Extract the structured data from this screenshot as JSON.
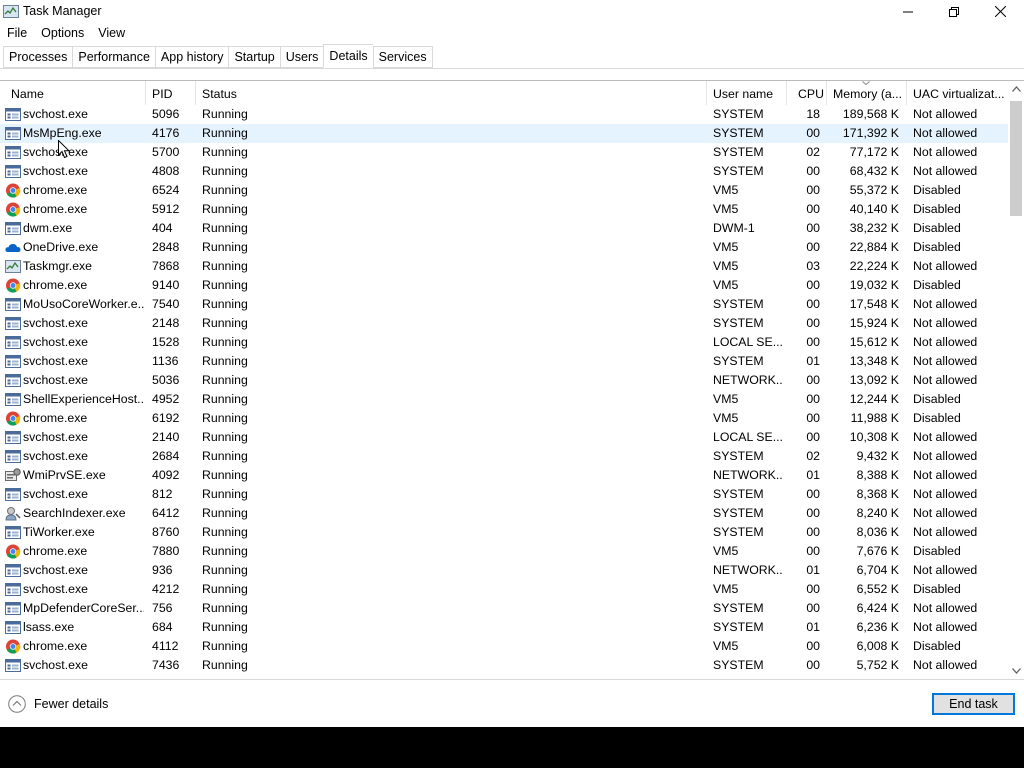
{
  "window": {
    "title": "Task Manager"
  },
  "menu": [
    "File",
    "Options",
    "View"
  ],
  "tabs": [
    {
      "label": "Processes",
      "active": false
    },
    {
      "label": "Performance",
      "active": false
    },
    {
      "label": "App history",
      "active": false
    },
    {
      "label": "Startup",
      "active": false
    },
    {
      "label": "Users",
      "active": false
    },
    {
      "label": "Details",
      "active": true
    },
    {
      "label": "Services",
      "active": false
    }
  ],
  "columns": {
    "name": "Name",
    "pid": "PID",
    "status": "Status",
    "user": "User name",
    "cpu": "CPU",
    "memory": "Memory (a...",
    "uac": "UAC virtualizat..."
  },
  "rows": [
    {
      "icon": "service",
      "name": "svchost.exe",
      "pid": "5096",
      "status": "Running",
      "user": "SYSTEM",
      "cpu": "18",
      "mem": "189,568 K",
      "uac": "Not allowed"
    },
    {
      "icon": "service",
      "name": "MsMpEng.exe",
      "pid": "4176",
      "status": "Running",
      "user": "SYSTEM",
      "cpu": "00",
      "mem": "171,392 K",
      "uac": "Not allowed",
      "selected": true
    },
    {
      "icon": "service",
      "name": "svchost.exe",
      "pid": "5700",
      "status": "Running",
      "user": "SYSTEM",
      "cpu": "02",
      "mem": "77,172 K",
      "uac": "Not allowed"
    },
    {
      "icon": "service",
      "name": "svchost.exe",
      "pid": "4808",
      "status": "Running",
      "user": "SYSTEM",
      "cpu": "00",
      "mem": "68,432 K",
      "uac": "Not allowed"
    },
    {
      "icon": "chrome",
      "name": "chrome.exe",
      "pid": "6524",
      "status": "Running",
      "user": "VM5",
      "cpu": "00",
      "mem": "55,372 K",
      "uac": "Disabled"
    },
    {
      "icon": "chrome",
      "name": "chrome.exe",
      "pid": "5912",
      "status": "Running",
      "user": "VM5",
      "cpu": "00",
      "mem": "40,140 K",
      "uac": "Disabled"
    },
    {
      "icon": "service",
      "name": "dwm.exe",
      "pid": "404",
      "status": "Running",
      "user": "DWM-1",
      "cpu": "00",
      "mem": "38,232 K",
      "uac": "Disabled"
    },
    {
      "icon": "onedrive",
      "name": "OneDrive.exe",
      "pid": "2848",
      "status": "Running",
      "user": "VM5",
      "cpu": "00",
      "mem": "22,884 K",
      "uac": "Disabled"
    },
    {
      "icon": "taskmgr",
      "name": "Taskmgr.exe",
      "pid": "7868",
      "status": "Running",
      "user": "VM5",
      "cpu": "03",
      "mem": "22,224 K",
      "uac": "Not allowed"
    },
    {
      "icon": "chrome",
      "name": "chrome.exe",
      "pid": "9140",
      "status": "Running",
      "user": "VM5",
      "cpu": "00",
      "mem": "19,032 K",
      "uac": "Disabled"
    },
    {
      "icon": "service",
      "name": "MoUsoCoreWorker.e...",
      "pid": "7540",
      "status": "Running",
      "user": "SYSTEM",
      "cpu": "00",
      "mem": "17,548 K",
      "uac": "Not allowed"
    },
    {
      "icon": "service",
      "name": "svchost.exe",
      "pid": "2148",
      "status": "Running",
      "user": "SYSTEM",
      "cpu": "00",
      "mem": "15,924 K",
      "uac": "Not allowed"
    },
    {
      "icon": "service",
      "name": "svchost.exe",
      "pid": "1528",
      "status": "Running",
      "user": "LOCAL SE...",
      "cpu": "00",
      "mem": "15,612 K",
      "uac": "Not allowed"
    },
    {
      "icon": "service",
      "name": "svchost.exe",
      "pid": "1136",
      "status": "Running",
      "user": "SYSTEM",
      "cpu": "01",
      "mem": "13,348 K",
      "uac": "Not allowed"
    },
    {
      "icon": "service",
      "name": "svchost.exe",
      "pid": "5036",
      "status": "Running",
      "user": "NETWORK...",
      "cpu": "00",
      "mem": "13,092 K",
      "uac": "Not allowed"
    },
    {
      "icon": "service",
      "name": "ShellExperienceHost....",
      "pid": "4952",
      "status": "Running",
      "user": "VM5",
      "cpu": "00",
      "mem": "12,244 K",
      "uac": "Disabled"
    },
    {
      "icon": "chrome",
      "name": "chrome.exe",
      "pid": "6192",
      "status": "Running",
      "user": "VM5",
      "cpu": "00",
      "mem": "11,988 K",
      "uac": "Disabled"
    },
    {
      "icon": "service",
      "name": "svchost.exe",
      "pid": "2140",
      "status": "Running",
      "user": "LOCAL SE...",
      "cpu": "00",
      "mem": "10,308 K",
      "uac": "Not allowed"
    },
    {
      "icon": "service",
      "name": "svchost.exe",
      "pid": "2684",
      "status": "Running",
      "user": "SYSTEM",
      "cpu": "02",
      "mem": "9,432 K",
      "uac": "Not allowed"
    },
    {
      "icon": "wmi",
      "name": "WmiPrvSE.exe",
      "pid": "4092",
      "status": "Running",
      "user": "NETWORK...",
      "cpu": "01",
      "mem": "8,388 K",
      "uac": "Not allowed"
    },
    {
      "icon": "service",
      "name": "svchost.exe",
      "pid": "812",
      "status": "Running",
      "user": "SYSTEM",
      "cpu": "00",
      "mem": "8,368 K",
      "uac": "Not allowed"
    },
    {
      "icon": "search",
      "name": "SearchIndexer.exe",
      "pid": "6412",
      "status": "Running",
      "user": "SYSTEM",
      "cpu": "00",
      "mem": "8,240 K",
      "uac": "Not allowed"
    },
    {
      "icon": "service",
      "name": "TiWorker.exe",
      "pid": "8760",
      "status": "Running",
      "user": "SYSTEM",
      "cpu": "00",
      "mem": "8,036 K",
      "uac": "Not allowed"
    },
    {
      "icon": "chrome",
      "name": "chrome.exe",
      "pid": "7880",
      "status": "Running",
      "user": "VM5",
      "cpu": "00",
      "mem": "7,676 K",
      "uac": "Disabled"
    },
    {
      "icon": "service",
      "name": "svchost.exe",
      "pid": "936",
      "status": "Running",
      "user": "NETWORK...",
      "cpu": "01",
      "mem": "6,704 K",
      "uac": "Not allowed"
    },
    {
      "icon": "service",
      "name": "svchost.exe",
      "pid": "4212",
      "status": "Running",
      "user": "VM5",
      "cpu": "00",
      "mem": "6,552 K",
      "uac": "Disabled"
    },
    {
      "icon": "service",
      "name": "MpDefenderCoreSer...",
      "pid": "756",
      "status": "Running",
      "user": "SYSTEM",
      "cpu": "00",
      "mem": "6,424 K",
      "uac": "Not allowed"
    },
    {
      "icon": "service",
      "name": "lsass.exe",
      "pid": "684",
      "status": "Running",
      "user": "SYSTEM",
      "cpu": "01",
      "mem": "6,236 K",
      "uac": "Not allowed"
    },
    {
      "icon": "chrome",
      "name": "chrome.exe",
      "pid": "4112",
      "status": "Running",
      "user": "VM5",
      "cpu": "00",
      "mem": "6,008 K",
      "uac": "Disabled"
    },
    {
      "icon": "service",
      "name": "svchost.exe",
      "pid": "7436",
      "status": "Running",
      "user": "SYSTEM",
      "cpu": "00",
      "mem": "5,752 K",
      "uac": "Not allowed"
    }
  ],
  "footer": {
    "fewer_details": "Fewer details",
    "end_task": "End task"
  },
  "colors": {
    "selection": "#e5f3ff",
    "accent": "#0078d7",
    "header_border": "#e5e5e5"
  }
}
